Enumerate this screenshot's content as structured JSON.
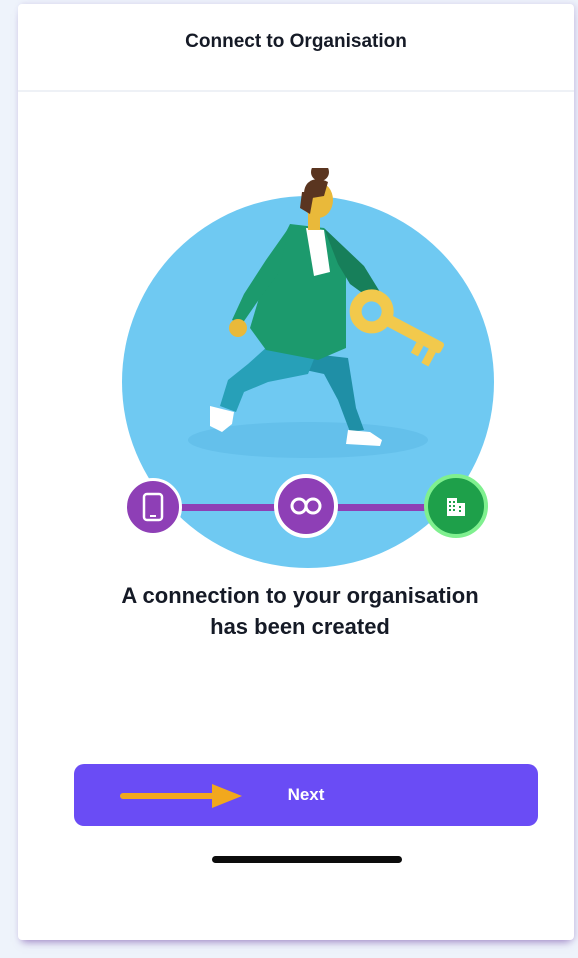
{
  "header": {
    "title": "Connect to Organisation"
  },
  "illustration": {
    "icon": "person-carrying-key-illustration",
    "circle_color": "#6fc9f2",
    "steps": [
      {
        "icon": "tablet-icon",
        "color": "#8e3fb6"
      },
      {
        "icon": "infinity-icon",
        "color": "#8e3fb6"
      },
      {
        "icon": "building-icon",
        "color": "#1ea04a"
      }
    ],
    "connector_color": "#8e3fb6"
  },
  "content": {
    "message": "A connection to your organisation has been created"
  },
  "actions": {
    "next_label": "Next",
    "next_color": "#6a4cf5",
    "annotation": "arrow-pointing-icon",
    "annotation_color": "#f2a81d"
  }
}
